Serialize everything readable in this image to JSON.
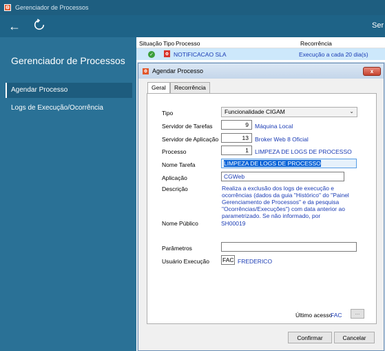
{
  "window": {
    "title": "Gerenciador de Processos"
  },
  "topbar": {
    "back_icon": "arrow-left-icon",
    "refresh_icon": "refresh-icon",
    "right_text": "Ser"
  },
  "sidebar": {
    "title": "Gerenciador de Processos",
    "items": [
      {
        "label": "Agendar Processo",
        "active": true
      },
      {
        "label": "Logs de Execução/Ocorrência",
        "active": false
      }
    ]
  },
  "grid": {
    "columns": [
      "Situação",
      "Tipo",
      "Processo",
      "Recorrência"
    ],
    "rows": [
      {
        "status_icon": "check-icon",
        "type_icon": "process-icon",
        "process": "NOTIFICACAO SLA",
        "recurrence": "Execução a cada 20 dia(s)"
      }
    ]
  },
  "dialog": {
    "title": "Agendar Processo",
    "close_label": "x",
    "tabs": [
      "Geral",
      "Recorrência"
    ],
    "fields": {
      "tipo": {
        "label": "Tipo",
        "value": "Funcionalidade CIGAM"
      },
      "servidor_tarefas": {
        "label": "Servidor de Tarefas",
        "code": "9",
        "name": "Máquina Local"
      },
      "servidor_aplicacao": {
        "label": "Servidor de Aplicação",
        "code": "13",
        "name": "Broker Web 8 Oficial"
      },
      "processo": {
        "label": "Processo",
        "code": "1",
        "name": "LIMPEZA DE LOGS DE PROCESSO"
      },
      "nome_tarefa": {
        "label": "Nome Tarefa",
        "value": "LIMPEZA DE LOGS DE PROCESSO"
      },
      "aplicacao": {
        "label": "Aplicação",
        "value": "CGWeb"
      },
      "descricao": {
        "label": "Descrição",
        "value": "Realiza a exclusão dos logs de execução e ocorrências (dados da guia \"Histórico\" do \"Painel Gerenciamento de Processos\" e da pesquisa \"Ocorrências/Execuções\") com data anterior ao parametrizado. Se não informado, por"
      },
      "nome_publico": {
        "label": "Nome Público",
        "value": "SH00019"
      },
      "parametros": {
        "label": "Parâmetros",
        "value": ""
      },
      "usuario_execucao": {
        "label": "Usuário Execução",
        "code": "FAC",
        "name": "FREDERICO"
      }
    },
    "ultimo_acesso": {
      "label": "Último acesso",
      "value": "FAC",
      "button": "..."
    },
    "buttons": {
      "confirm": "Confirmar",
      "cancel": "Cancelar"
    }
  },
  "colors": {
    "sidebar": "#2a7196",
    "topbar": "#1e6387",
    "accent_text": "#1a3bb4",
    "selected_row": "#cde8fb"
  }
}
